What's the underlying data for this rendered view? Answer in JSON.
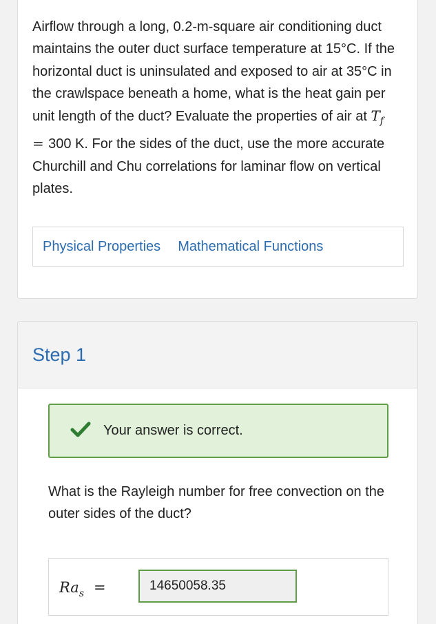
{
  "problem": {
    "text_part1": "Airflow through a long, 0.2-m-square air conditioning duct maintains the outer duct surface temperature at 15°C. If the horizontal duct is uninsulated and exposed to air at 35°C in the crawlspace beneath a home, what is the heat gain per unit length of the duct? Evaluate the properties of air at ",
    "math_var": "T",
    "math_sub": "f",
    "math_eq": " = ",
    "math_value": "300 K",
    "text_part2": ". For the sides of the duct, use the more accurate Churchill and Chu correlations for laminar flow on vertical plates.",
    "links": [
      "Physical Properties",
      "Mathematical Functions"
    ]
  },
  "step": {
    "title": "Step 1",
    "feedback": "Your answer is correct.",
    "question": "What is the Rayleigh number for free convection on the outer sides of the duct?",
    "answer_label_var": "Ra",
    "answer_label_sub": "s",
    "answer_label_eq": "=",
    "answer_value": "14650058.35"
  },
  "colors": {
    "link": "#2b6cb0",
    "success_bg": "#e2f2da",
    "success_border": "#5f9e46"
  },
  "icons": {
    "feedback": "check-icon"
  }
}
